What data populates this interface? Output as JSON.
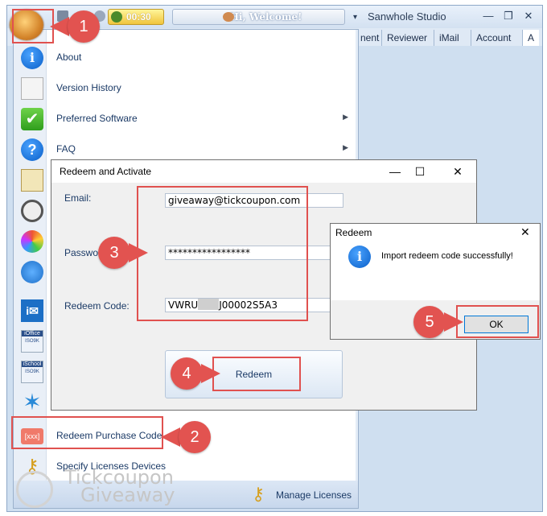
{
  "app": {
    "title": "Sanwhole Studio",
    "timer": "00:30",
    "welcome": "Hi, Welcome!",
    "tabs": [
      "nent",
      "Reviewer",
      "iMail",
      "Account",
      "A"
    ]
  },
  "menu": {
    "items": [
      {
        "label": "About",
        "icon": "info-icon",
        "submenu": false
      },
      {
        "label": "Version History",
        "icon": "history-icon",
        "submenu": false
      },
      {
        "label": "Preferred Software",
        "icon": "checkmark-icon",
        "submenu": true
      },
      {
        "label": "FAQ",
        "icon": "question-icon",
        "submenu": true
      },
      {
        "label": "",
        "icon": "settings-window-icon",
        "submenu": false
      },
      {
        "label": "",
        "icon": "clock-icon",
        "submenu": false
      },
      {
        "label": "",
        "icon": "palette-icon",
        "submenu": false
      },
      {
        "label": "",
        "icon": "language-icon",
        "submenu": false
      },
      {
        "label": "",
        "icon": "imail-icon",
        "submenu": false
      },
      {
        "label": "",
        "icon": "ioffice-icon",
        "submenu": false
      },
      {
        "label": "",
        "icon": "ischool-icon",
        "submenu": false
      },
      {
        "label": "",
        "icon": "star-logo-icon",
        "submenu": false
      },
      {
        "label": "Redeem Purchase Code",
        "icon": "redeem-code-icon",
        "submenu": false
      },
      {
        "label": "Specify Licenses Devices",
        "icon": "keys-icon",
        "submenu": false
      }
    ],
    "ioffice_badge": "iOffice",
    "ischool_badge": "iSchool",
    "iso_text": "ISO9K",
    "redeem_icon_text": "[xxx]",
    "footer_button": "Manage Licenses"
  },
  "redeem_dialog": {
    "title": "Redeem and Activate",
    "email_label": "Email:",
    "email_value": "giveaway@tickcoupon.com",
    "password_label": "Passwo",
    "password_value": "*****************",
    "redeem_code_label": "Redeem Code:",
    "redeem_code_prefix": "VWRU",
    "redeem_code_suffix": "J00002S5A3",
    "button_label": "Redeem"
  },
  "popup": {
    "title": "Redeem",
    "message": "Import redeem code successfully!",
    "ok_label": "OK"
  },
  "annotations": [
    "1",
    "2",
    "3",
    "4",
    "5"
  ],
  "watermark": {
    "line1": "Tickcoupon",
    "line2": "Giveaway"
  },
  "colors": {
    "annotation_red": "#e0514f",
    "accent_blue": "#0078d7"
  }
}
